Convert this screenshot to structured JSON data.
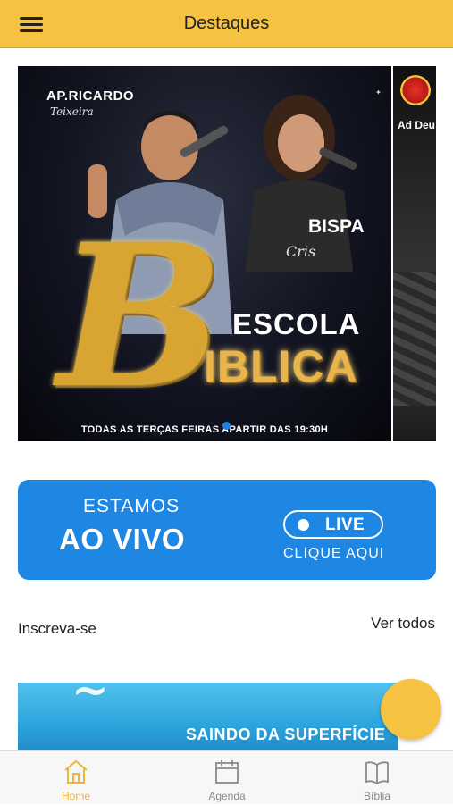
{
  "header": {
    "title": "Destaques",
    "menu_icon": "hamburger-icon"
  },
  "banner": {
    "speaker1": "AP.RICARDO",
    "speaker1_signature": "Teixeira",
    "speaker2": "BISPA",
    "speaker2_signature": "Cris",
    "title_line1": "ESCOLA",
    "title_line2": "IBLICA",
    "big_letter": "B",
    "schedule": "TODAS AS TERÇAS FEIRAS APARTIR DAS 19:30H",
    "next_slide_label": "Ad Deu"
  },
  "live": {
    "line1": "ESTAMOS",
    "line2": "AO VIVO",
    "pill_label": "LIVE",
    "cta": "CLIQUE AQUI"
  },
  "subscribe": {
    "title": "Inscreva-se",
    "see_all": "Ver todos"
  },
  "thumbnail": {
    "text": "SAINDO DA SUPERFÍCIE"
  },
  "bottom_nav": [
    {
      "label": "Home",
      "icon": "home-icon",
      "active": true
    },
    {
      "label": "Agenda",
      "icon": "calendar-icon",
      "active": false
    },
    {
      "label": "Bíblia",
      "icon": "bible-icon",
      "active": false
    }
  ],
  "colors": {
    "accent": "#f5c242",
    "live_blue": "#1e86e3",
    "nav_active": "#f0b43b",
    "nav_inactive": "#8a8a8a"
  }
}
